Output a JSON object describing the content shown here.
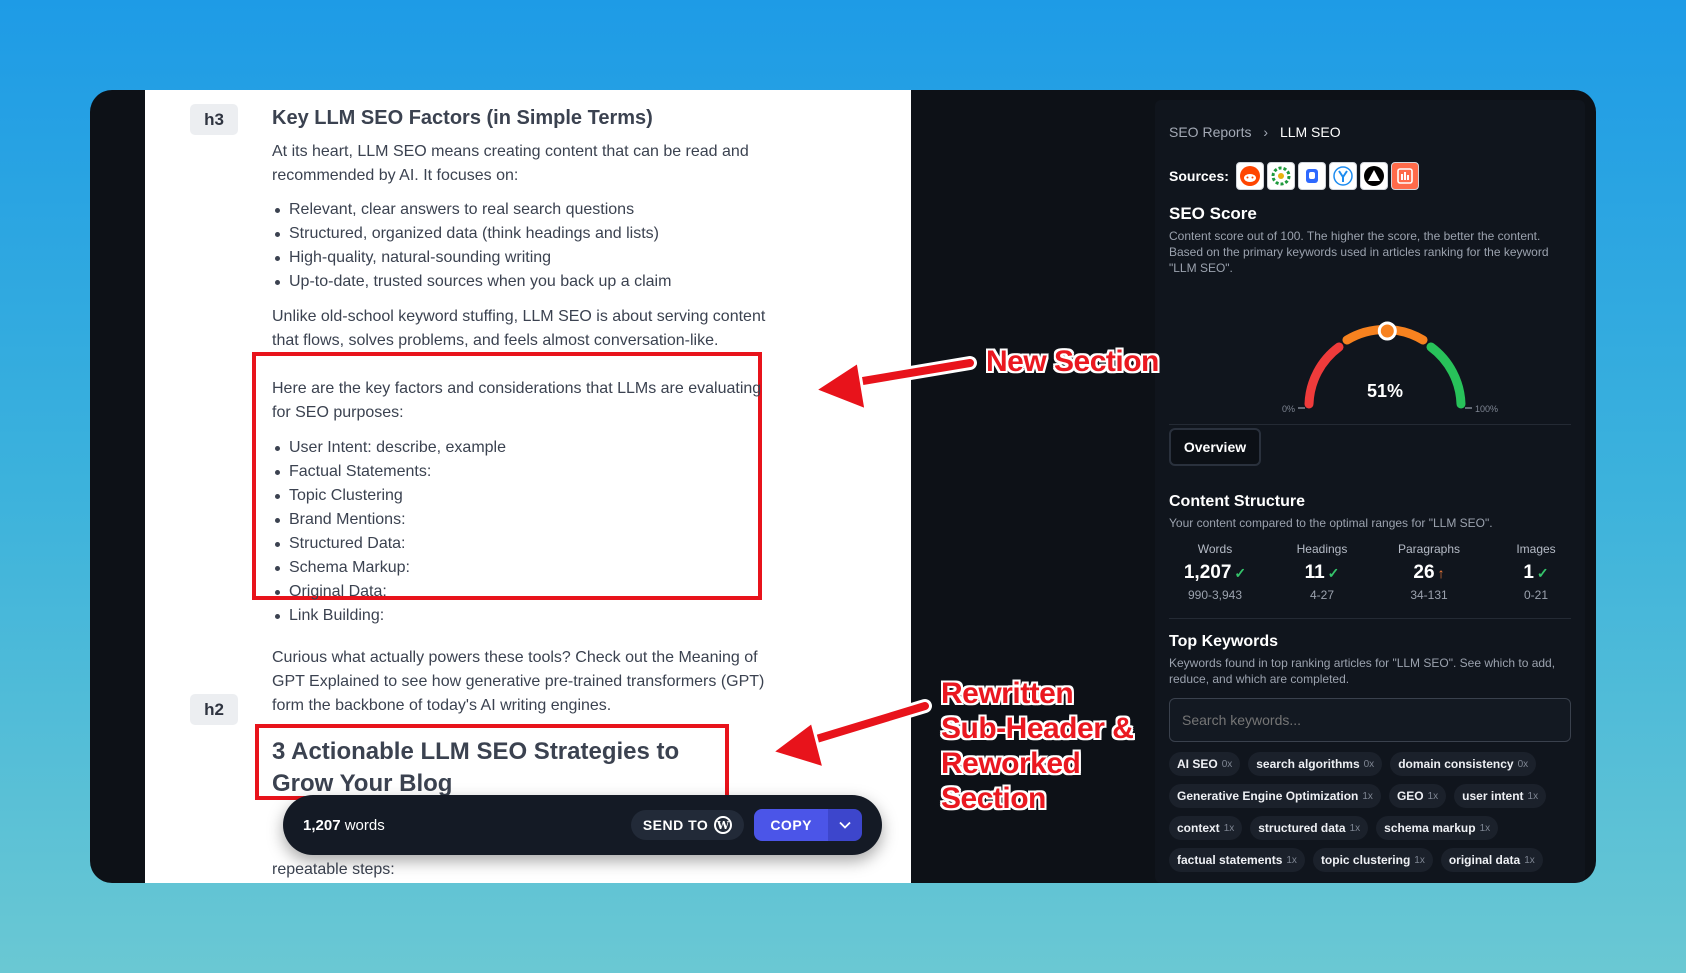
{
  "doc": {
    "tag_h3": "h3",
    "tag_h2": "h2",
    "h3_title": "Key LLM SEO Factors (in Simple Terms)",
    "intro": "At its heart, LLM SEO means creating content that can be read and recommended by AI. It focuses on:",
    "bullets1": [
      "Relevant, clear answers to real search questions",
      "Structured, organized data (think headings and lists)",
      "High-quality, natural-sounding writing",
      "Up-to-date, trusted sources when you back up a claim"
    ],
    "para2": "Unlike old-school keyword stuffing, LLM SEO is about serving content that flows, solves problems, and feels almost conversation-like.",
    "new_intro": "Here are the key factors and considerations that LLMs are evaluating for SEO purposes:",
    "bullets2": [
      "User Intent: describe, example",
      "Factual Statements:",
      "Topic Clustering",
      "Brand Mentions:",
      "Structured Data:",
      "Schema Markup:",
      "Original Data:",
      "Link Building:"
    ],
    "para3": "Curious what actually powers these tools? Check out the Meaning of GPT Explained to see how generative pre-trained transformers (GPT) form the backbone of today's AI writing engines.",
    "h2_title": "3 Actionable LLM SEO Strategies to Grow Your Blog",
    "tail": "repeatable steps:"
  },
  "toolbar": {
    "word_count": "1,207",
    "word_label": "words",
    "send_label": "SEND TO",
    "copy_label": "COPY"
  },
  "annotations": {
    "new_section": "New Section",
    "rewritten": [
      "Rewritten",
      "Sub-Header &",
      "Reworked",
      "Section"
    ],
    "color": "#e8131b"
  },
  "panel": {
    "breadcrumb": [
      "SEO Reports",
      "LLM SEO"
    ],
    "sources_label": "Sources:",
    "sources": [
      {
        "icon": "reddit-icon",
        "color": "#ff4500"
      },
      {
        "icon": "openai-icon",
        "color": "#1f9a3d"
      },
      {
        "icon": "quora-icon",
        "color": "#2e69ff"
      },
      {
        "icon": "ycombinator-icon",
        "color": "#1d8cf0"
      },
      {
        "icon": "triangle-icon",
        "color": "#000000"
      },
      {
        "icon": "bar-chart-icon",
        "color": "#ff6b4a"
      }
    ],
    "score_title": "SEO Score",
    "score_desc": "Content score out of 100. The higher the score, the better the content. Based on the primary keywords used in articles ranking for the keyword \"LLM SEO\".",
    "score_value": 0.51,
    "score_text": "51%",
    "gauge_min": "0%",
    "gauge_max": "100%",
    "overview_tab": "Overview",
    "structure_title": "Content Structure",
    "structure_desc": "Your content compared to the optimal ranges for \"LLM SEO\".",
    "stats": [
      {
        "label": "Words",
        "value": "1,207",
        "status": "ok",
        "range": "990-3,943"
      },
      {
        "label": "Headings",
        "value": "11",
        "status": "ok",
        "range": "4-27"
      },
      {
        "label": "Paragraphs",
        "value": "26",
        "status": "up",
        "range": "34-131"
      },
      {
        "label": "Images",
        "value": "1",
        "status": "ok",
        "range": "0-21"
      }
    ],
    "keywords_title": "Top Keywords",
    "keywords_desc": "Keywords found in top ranking articles for \"LLM SEO\". See which to add, reduce, and which are completed.",
    "search_placeholder": "Search keywords...",
    "keywords": [
      {
        "k": "AI SEO",
        "n": "0x"
      },
      {
        "k": "search algorithms",
        "n": "0x"
      },
      {
        "k": "domain consistency",
        "n": "0x"
      },
      {
        "k": "Generative Engine Optimization",
        "n": "1x"
      },
      {
        "k": "GEO",
        "n": "1x"
      },
      {
        "k": "user intent",
        "n": "1x"
      },
      {
        "k": "context",
        "n": "1x"
      },
      {
        "k": "structured data",
        "n": "1x"
      },
      {
        "k": "schema markup",
        "n": "1x"
      },
      {
        "k": "factual statements",
        "n": "1x"
      },
      {
        "k": "topic clustering",
        "n": "1x"
      },
      {
        "k": "original data",
        "n": "1x"
      }
    ]
  }
}
